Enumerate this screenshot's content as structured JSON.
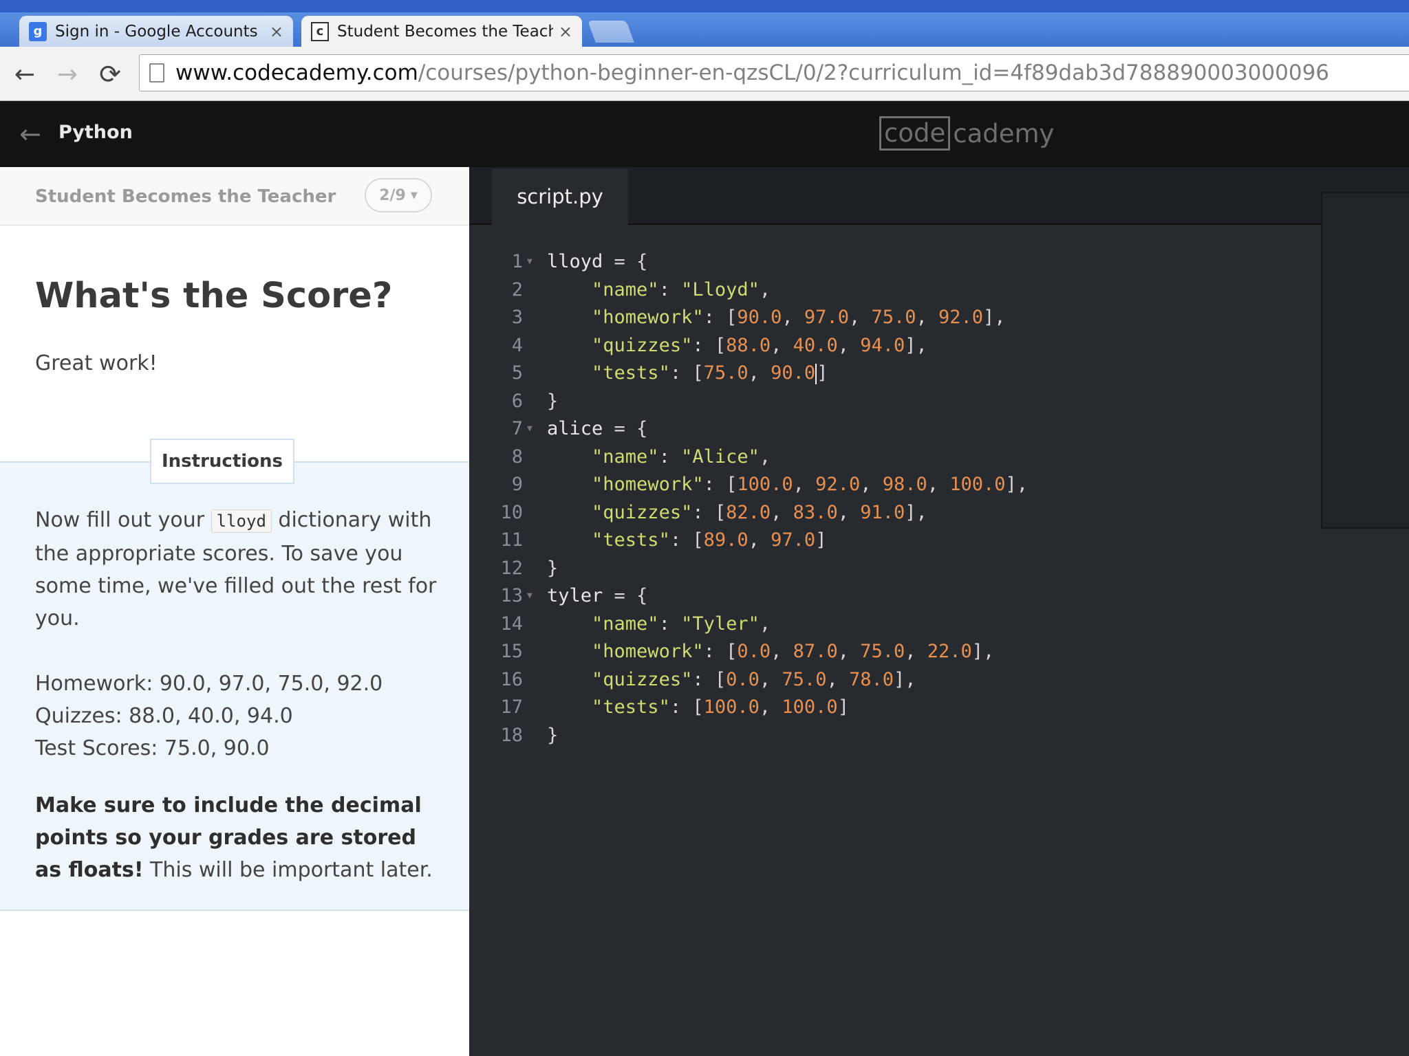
{
  "browser": {
    "tabs": [
      {
        "title": "Sign in - Google Accounts",
        "favicon": "google-favicon-icon",
        "close": "×"
      },
      {
        "title": "Student Becomes the Teache",
        "favicon": "codecademy-favicon-icon",
        "close": "×"
      }
    ],
    "url_host": "www.codecademy.com",
    "url_path": "/courses/python-beginner-en-qzsCL/0/2?curriculum_id=4f89dab3d788890003000096",
    "icons": {
      "back": "←",
      "forward": "→",
      "reload": "⟳",
      "google_favicon": "g",
      "codecademy_favicon": "c"
    }
  },
  "header": {
    "back_icon": "←",
    "course": "Python",
    "logo_boxed": "code",
    "logo_rest": "cademy"
  },
  "lesson": {
    "name": "Student Becomes the Teacher",
    "progress": "2/9",
    "progress_caret": "▼",
    "title": "What's the Score?",
    "intro": "Great work!",
    "instructions_label": "Instructions",
    "p1_before": "Now fill out your ",
    "p1_code": "lloyd",
    "p1_after": " dictionary with the appropriate scores. To save you some time, we've filled out the rest for you.",
    "scores": [
      "Homework: 90.0, 97.0, 75.0, 92.0",
      "Quizzes: 88.0, 40.0, 94.0",
      "Test Scores: 75.0, 90.0"
    ],
    "p3_bold": "Make sure to include the decimal points so your grades are stored as floats!",
    "p3_rest": " This will be important later."
  },
  "editor": {
    "file_tab": "script.py",
    "fold_icon": "▼",
    "lines": [
      [
        [
          "ident",
          "lloyd"
        ],
        [
          "punc",
          " = {"
        ]
      ],
      [
        [
          "punc",
          "    "
        ],
        [
          "str",
          "\"name\""
        ],
        [
          "punc",
          ": "
        ],
        [
          "str",
          "\"Lloyd\""
        ],
        [
          "punc",
          ","
        ]
      ],
      [
        [
          "punc",
          "    "
        ],
        [
          "str",
          "\"homework\""
        ],
        [
          "punc",
          ": ["
        ],
        [
          "num",
          "90.0"
        ],
        [
          "punc",
          ", "
        ],
        [
          "num",
          "97.0"
        ],
        [
          "punc",
          ", "
        ],
        [
          "num",
          "75.0"
        ],
        [
          "punc",
          ", "
        ],
        [
          "num",
          "92.0"
        ],
        [
          "punc",
          "],"
        ]
      ],
      [
        [
          "punc",
          "    "
        ],
        [
          "str",
          "\"quizzes\""
        ],
        [
          "punc",
          ": ["
        ],
        [
          "num",
          "88.0"
        ],
        [
          "punc",
          ", "
        ],
        [
          "num",
          "40.0"
        ],
        [
          "punc",
          ", "
        ],
        [
          "num",
          "94.0"
        ],
        [
          "punc",
          "],"
        ]
      ],
      [
        [
          "punc",
          "    "
        ],
        [
          "str",
          "\"tests\""
        ],
        [
          "punc",
          ": ["
        ],
        [
          "num",
          "75.0"
        ],
        [
          "punc",
          ", "
        ],
        [
          "num",
          "90.0"
        ],
        [
          "caret",
          ""
        ],
        [
          "punc",
          "]"
        ]
      ],
      [
        [
          "punc",
          "}"
        ]
      ],
      [
        [
          "ident",
          "alice"
        ],
        [
          "punc",
          " = {"
        ]
      ],
      [
        [
          "punc",
          "    "
        ],
        [
          "str",
          "\"name\""
        ],
        [
          "punc",
          ": "
        ],
        [
          "str",
          "\"Alice\""
        ],
        [
          "punc",
          ","
        ]
      ],
      [
        [
          "punc",
          "    "
        ],
        [
          "str",
          "\"homework\""
        ],
        [
          "punc",
          ": ["
        ],
        [
          "num",
          "100.0"
        ],
        [
          "punc",
          ", "
        ],
        [
          "num",
          "92.0"
        ],
        [
          "punc",
          ", "
        ],
        [
          "num",
          "98.0"
        ],
        [
          "punc",
          ", "
        ],
        [
          "num",
          "100.0"
        ],
        [
          "punc",
          "],"
        ]
      ],
      [
        [
          "punc",
          "    "
        ],
        [
          "str",
          "\"quizzes\""
        ],
        [
          "punc",
          ": ["
        ],
        [
          "num",
          "82.0"
        ],
        [
          "punc",
          ", "
        ],
        [
          "num",
          "83.0"
        ],
        [
          "punc",
          ", "
        ],
        [
          "num",
          "91.0"
        ],
        [
          "punc",
          "],"
        ]
      ],
      [
        [
          "punc",
          "    "
        ],
        [
          "str",
          "\"tests\""
        ],
        [
          "punc",
          ": ["
        ],
        [
          "num",
          "89.0"
        ],
        [
          "punc",
          ", "
        ],
        [
          "num",
          "97.0"
        ],
        [
          "punc",
          "]"
        ]
      ],
      [
        [
          "punc",
          "}"
        ]
      ],
      [
        [
          "ident",
          "tyler"
        ],
        [
          "punc",
          " = {"
        ]
      ],
      [
        [
          "punc",
          "    "
        ],
        [
          "str",
          "\"name\""
        ],
        [
          "punc",
          ": "
        ],
        [
          "str",
          "\"Tyler\""
        ],
        [
          "punc",
          ","
        ]
      ],
      [
        [
          "punc",
          "    "
        ],
        [
          "str",
          "\"homework\""
        ],
        [
          "punc",
          ": ["
        ],
        [
          "num",
          "0.0"
        ],
        [
          "punc",
          ", "
        ],
        [
          "num",
          "87.0"
        ],
        [
          "punc",
          ", "
        ],
        [
          "num",
          "75.0"
        ],
        [
          "punc",
          ", "
        ],
        [
          "num",
          "22.0"
        ],
        [
          "punc",
          "],"
        ]
      ],
      [
        [
          "punc",
          "    "
        ],
        [
          "str",
          "\"quizzes\""
        ],
        [
          "punc",
          ": ["
        ],
        [
          "num",
          "0.0"
        ],
        [
          "punc",
          ", "
        ],
        [
          "num",
          "75.0"
        ],
        [
          "punc",
          ", "
        ],
        [
          "num",
          "78.0"
        ],
        [
          "punc",
          "],"
        ]
      ],
      [
        [
          "punc",
          "    "
        ],
        [
          "str",
          "\"tests\""
        ],
        [
          "punc",
          ": ["
        ],
        [
          "num",
          "100.0"
        ],
        [
          "punc",
          ", "
        ],
        [
          "num",
          "100.0"
        ],
        [
          "punc",
          "]"
        ]
      ],
      [
        [
          "punc",
          "}"
        ]
      ]
    ],
    "foldable_lines": [
      1,
      7,
      13
    ]
  }
}
